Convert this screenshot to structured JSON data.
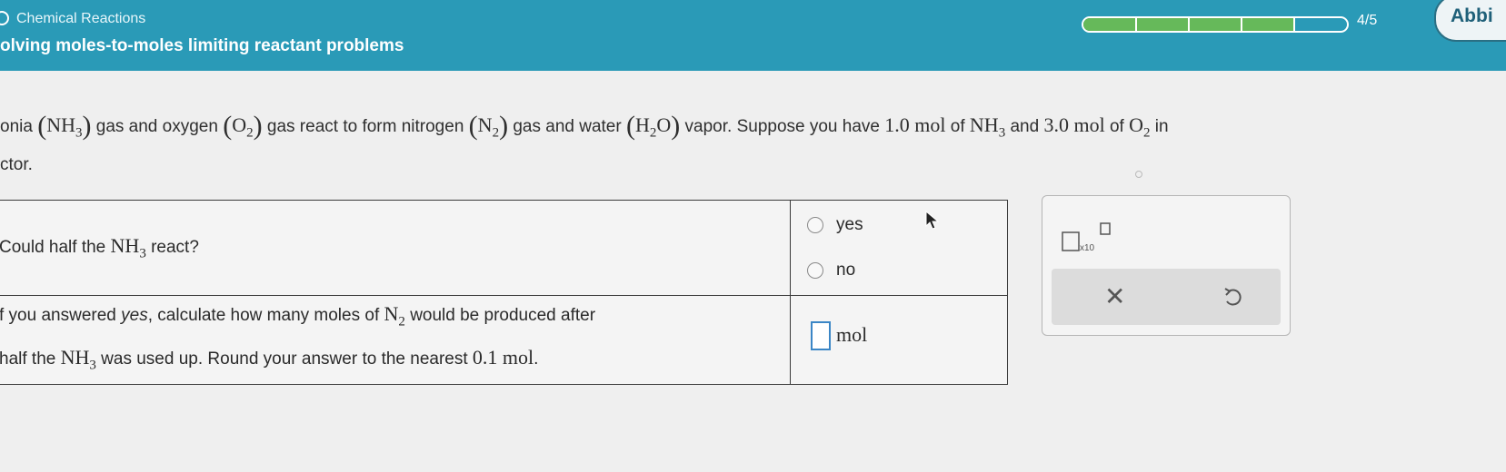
{
  "header": {
    "topic": "Chemical Reactions",
    "subtopic": "olving moles-to-moles limiting reactant problems",
    "progress": {
      "filled_segments": 4,
      "total_segments": 5,
      "label": "4/5"
    },
    "user_name": "Abbi"
  },
  "problem": {
    "p1": "onia",
    "nh3": "NH",
    "nh3_sub": "3",
    "p2": "gas and oxygen",
    "o2": "O",
    "o2_sub": "2",
    "p3": "gas react to form nitrogen",
    "n2": "N",
    "n2_sub": "2",
    "p4": "gas and water",
    "h2o_h": "H",
    "h2o_sub": "2",
    "h2o_o": "O",
    "p5": "vapor. Suppose you have",
    "amount1": "1.0 mol",
    "p6": "of",
    "p7": "and",
    "amount2": "3.0 mol",
    "p8": "of",
    "p9": "in",
    "line2": "ctor."
  },
  "questions": {
    "q1_prefix": "Could half the",
    "q1_suffix": "react?",
    "q1_options": [
      "yes",
      "no"
    ],
    "q2_a": "f you answered",
    "q2_yes": "yes",
    "q2_b": ", calculate how many moles of",
    "q2_c": "would be produced after",
    "q2_d": "half the",
    "q2_e": "was used up. Round your answer to the nearest",
    "q2_round": "0.1 mol",
    "q2_f": ".",
    "answer_value": "",
    "unit": "mol"
  },
  "tools": {
    "x10_label": "x10",
    "clear_icon": "close-icon",
    "undo_icon": "undo-icon",
    "clear_symbol": "✕"
  },
  "colors": {
    "header_bg": "#2a9ab7",
    "progress_fill": "#66b95a",
    "input_border": "#3b86c6"
  }
}
